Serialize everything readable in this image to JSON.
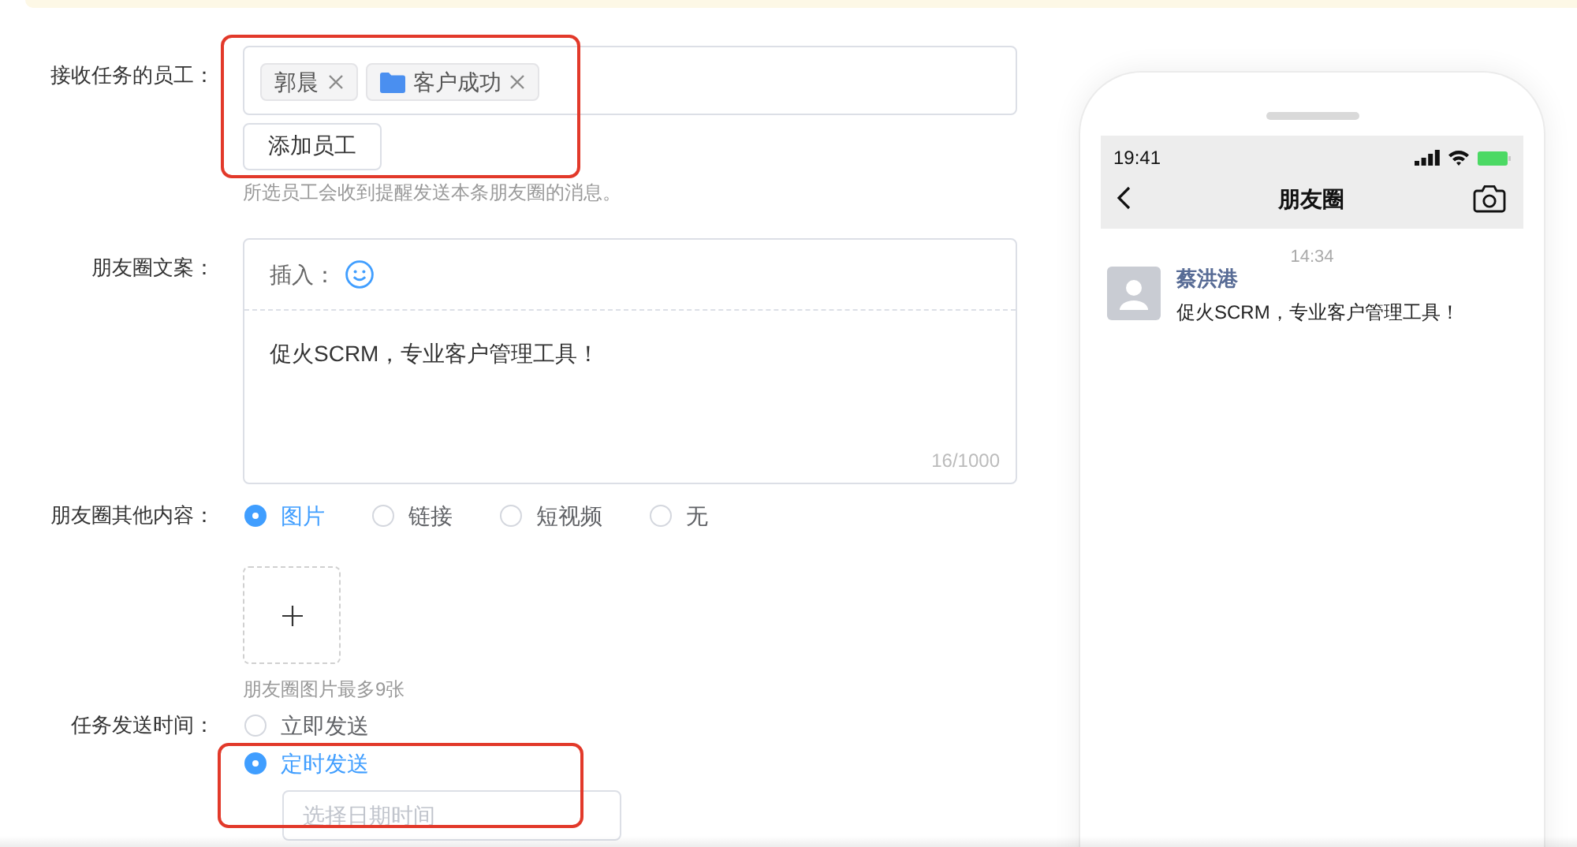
{
  "form": {
    "receivers": {
      "label": "接收任务的员工：",
      "tags": [
        {
          "kind": "person",
          "text": "郭晨"
        },
        {
          "kind": "department",
          "text": "客户成功"
        }
      ],
      "add_button": "添加员工",
      "hint": "所选员工会收到提醒发送本条朋友圈的消息。",
      "highlighted": true
    },
    "copy": {
      "label": "朋友圈文案：",
      "insert_label": "插入：",
      "value": "促火SCRM，专业客户管理工具！",
      "counter": "16/1000"
    },
    "other_content": {
      "label": "朋友圈其他内容：",
      "options": [
        {
          "label": "图片",
          "selected": true
        },
        {
          "label": "链接",
          "selected": false
        },
        {
          "label": "短视频",
          "selected": false
        },
        {
          "label": "无",
          "selected": false
        }
      ],
      "upload_hint": "朋友圈图片最多9张"
    },
    "send_time": {
      "label": "任务发送时间：",
      "options": [
        {
          "label": "立即发送",
          "selected": false
        },
        {
          "label": "定时发送",
          "selected": true
        }
      ],
      "datetime_placeholder": "选择日期时间",
      "highlighted": true
    }
  },
  "preview": {
    "status_time": "19:41",
    "title": "朋友圈",
    "post": {
      "time": "14:34",
      "author": "蔡洪港",
      "text": "促火SCRM，专业客户管理工具！"
    }
  }
}
